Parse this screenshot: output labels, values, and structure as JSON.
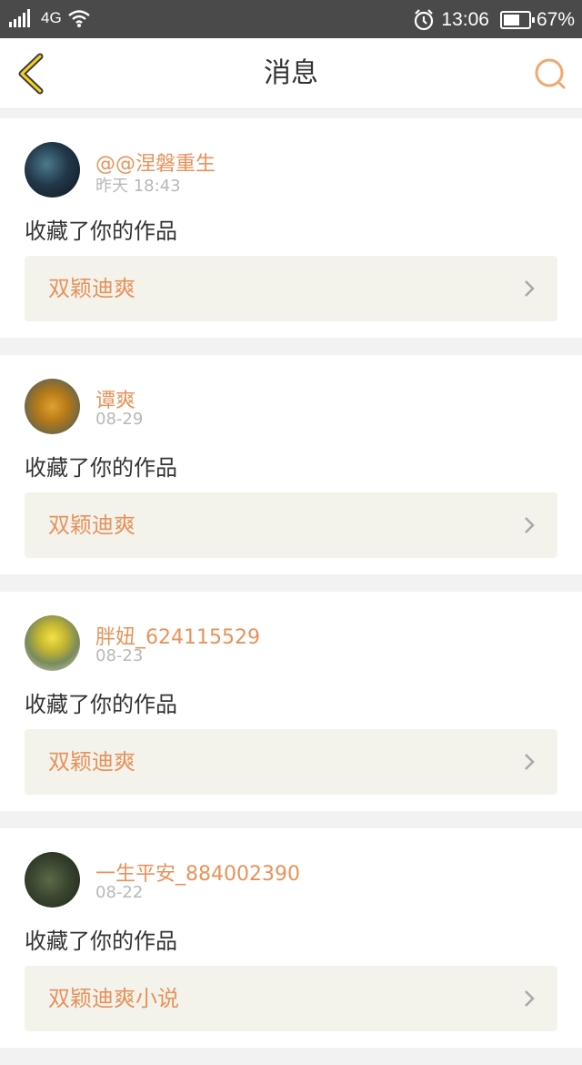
{
  "status_bar": {
    "network": "4G",
    "time": "13:06",
    "battery": "67%",
    "battery_level": 0.67
  },
  "header": {
    "title": "消息",
    "back_icon": "chevron-left-icon",
    "search_icon": "search-icon",
    "accent_color": "#e8925a"
  },
  "messages": [
    {
      "username": "@@涅磐重生",
      "time": "昨天 18:43",
      "action": "收藏了你的作品",
      "work": "双颖迪爽"
    },
    {
      "username": "谭爽",
      "time": "08-29",
      "action": "收藏了你的作品",
      "work": "双颖迪爽"
    },
    {
      "username": "胖妞_624115529",
      "time": "08-23",
      "action": "收藏了你的作品",
      "work": "双颖迪爽"
    },
    {
      "username": "一生平安_884002390",
      "time": "08-22",
      "action": "收藏了你的作品",
      "work": "双颖迪爽小说"
    }
  ]
}
